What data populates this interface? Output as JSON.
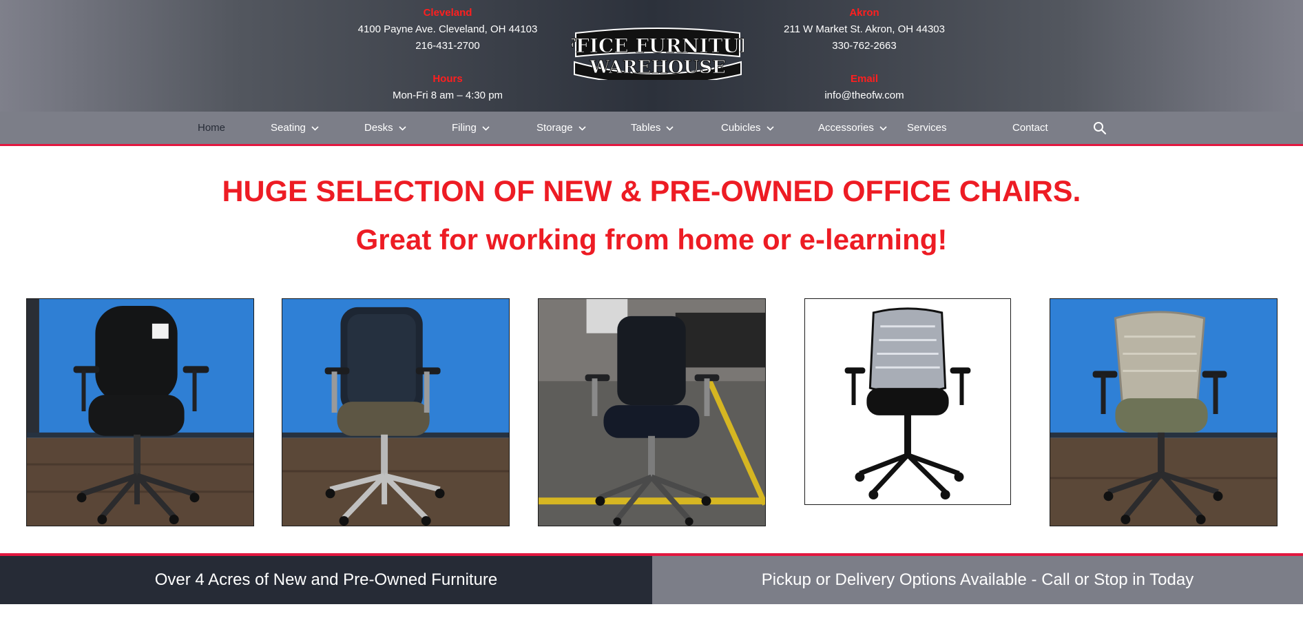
{
  "header": {
    "cleveland": {
      "label": "Cleveland",
      "address": "4100 Payne Ave. Cleveland, OH 44103",
      "phone": "216-431-2700"
    },
    "hours": {
      "label": "Hours",
      "text": "Mon-Fri 8 am – 4:30 pm"
    },
    "akron": {
      "label": "Akron",
      "address": "211 W Market St. Akron, OH 44303",
      "phone": "330-762-2663"
    },
    "email": {
      "label": "Email",
      "text": "info@theofw.com"
    },
    "logo": {
      "line1": "OFFICE FURNITURE",
      "line2": "WAREHOUSE"
    }
  },
  "nav": {
    "items": [
      {
        "label": "Home",
        "dropdown": false,
        "active": true
      },
      {
        "label": "Seating",
        "dropdown": true
      },
      {
        "label": "Desks",
        "dropdown": true
      },
      {
        "label": "Filing",
        "dropdown": true
      },
      {
        "label": "Storage",
        "dropdown": true
      },
      {
        "label": "Tables",
        "dropdown": true
      },
      {
        "label": "Cubicles",
        "dropdown": true
      },
      {
        "label": "Accessories",
        "dropdown": true
      },
      {
        "label": "Services",
        "dropdown": false
      },
      {
        "label": "Contact",
        "dropdown": false
      }
    ],
    "search_icon": "search-icon"
  },
  "hero": {
    "headline": "HUGE SELECTION OF NEW & PRE-OWNED OFFICE CHAIRS.",
    "subheadline": "Great for working from home or e-learning!"
  },
  "banner": {
    "left": "Over 4 Acres of New and Pre-Owned Furniture",
    "right": "Pickup or Delivery Options Available - Call or Stop in Today"
  },
  "colors": {
    "accent_red": "#ed1c24",
    "nav_border": "#e2173f",
    "dark_navy": "#262b36",
    "nav_gray": "#7c7e88"
  }
}
